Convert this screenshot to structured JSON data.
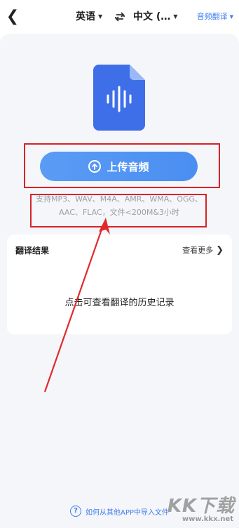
{
  "header": {
    "back_icon": "back-chevron-icon",
    "source_language": "英语",
    "target_language": "中文 (…",
    "swap_icon": "swap-icon",
    "mode_label": "音频翻译"
  },
  "upload": {
    "file_icon": "audio-file-icon",
    "button_label": "上传音频",
    "support_text": "支持MP3、WAV、M4A、AMR、WMA、OGG、AAC、FLAC，文件<200M&3小时"
  },
  "results": {
    "title": "翻译结果",
    "more_label": "查看更多",
    "history_label": "点击可查看翻译的历史记录"
  },
  "footer": {
    "help_label": "如何从其他APP中导入文件"
  },
  "watermark": {
    "logo": "KK下载",
    "url": "www.kkx.net"
  },
  "colors": {
    "accent": "#4a8ef2",
    "highlight": "#d8232a",
    "background": "#f5f6f9"
  }
}
